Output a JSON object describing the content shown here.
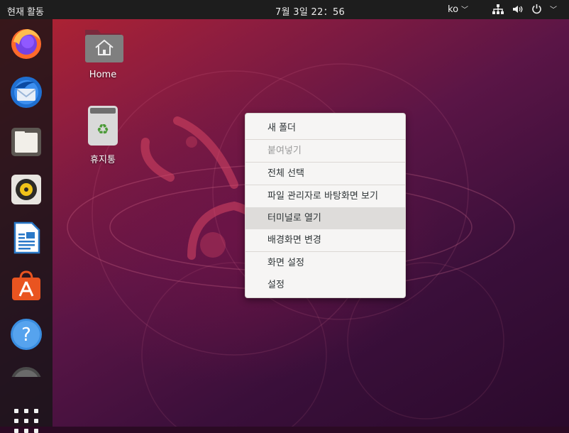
{
  "topbar": {
    "activities": "현재 활동",
    "clock": "7월 3일  22：56",
    "lang": "ko",
    "lang_chev": "﹀",
    "sys_chev": "﹀"
  },
  "dock": {
    "items": [
      "firefox",
      "thunderbird",
      "files",
      "rhythmbox",
      "libreoffice-writer",
      "ubuntu-software",
      "help"
    ]
  },
  "desktop": {
    "icons": [
      {
        "label": "Home"
      },
      {
        "label": "휴지통"
      }
    ]
  },
  "context_menu": {
    "items": [
      {
        "label": "새 폴더",
        "state": "normal"
      },
      {
        "label": "붙여넣기",
        "state": "disabled"
      },
      {
        "label": "전체 선택",
        "state": "normal"
      },
      {
        "label": "파일 관리자로 바탕화면 보기",
        "state": "normal"
      },
      {
        "label": "터미널로 열기",
        "state": "hover"
      },
      {
        "label": "배경화면 변경",
        "state": "normal"
      },
      {
        "label": "화면 설정",
        "state": "normal"
      },
      {
        "label": "설정",
        "state": "normal"
      }
    ]
  },
  "colors": {
    "topbar": "#1d1d1d",
    "dock": "#141414",
    "menu_bg": "#f6f5f4",
    "menu_hover": "#dedcda",
    "accent": "#e95420"
  }
}
